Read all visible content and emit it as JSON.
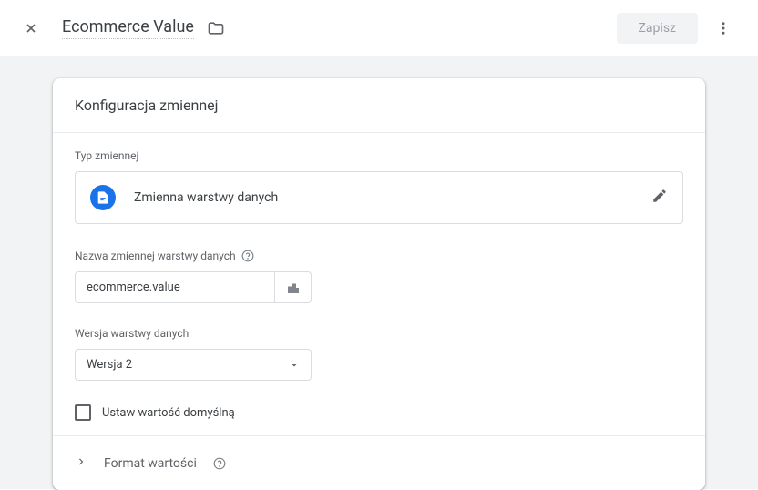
{
  "header": {
    "title": "Ecommerce Value",
    "save_label": "Zapisz"
  },
  "card": {
    "title": "Konfiguracja zmiennej",
    "type_label": "Typ zmiennej",
    "type_name": "Zmienna warstwy danych",
    "var_name_label": "Nazwa zmiennej warstwy danych",
    "var_name_value": "ecommerce.value",
    "version_label": "Wersja warstwy danych",
    "version_value": "Wersja 2",
    "default_checkbox_label": "Ustaw wartość domyślną",
    "format_label": "Format wartości"
  }
}
